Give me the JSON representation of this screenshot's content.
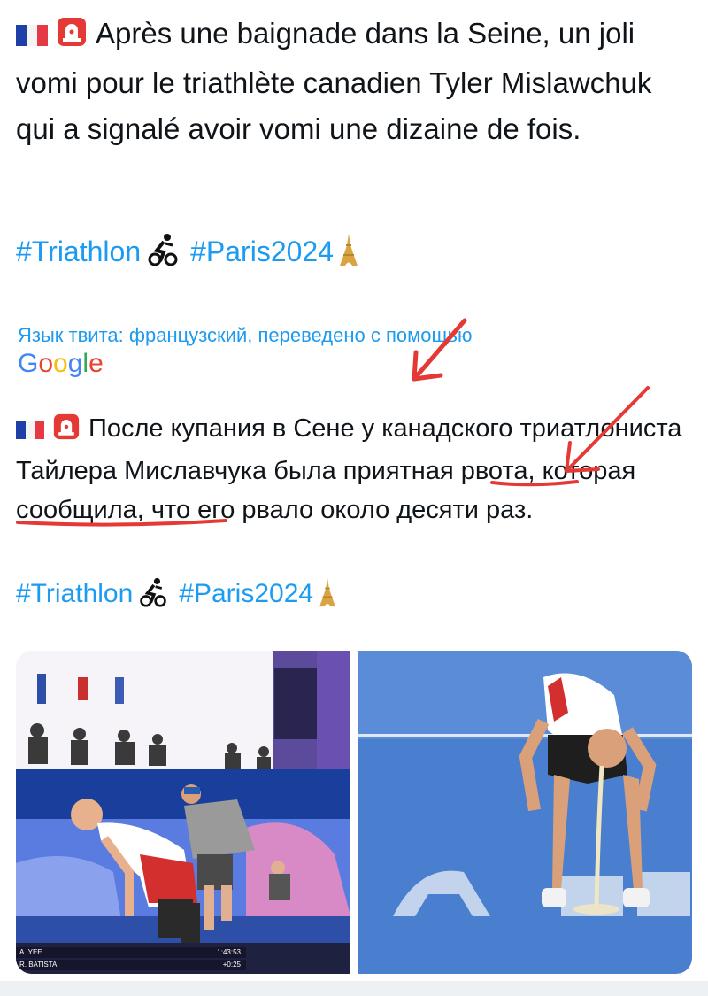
{
  "original": {
    "text": "Après une baignade dans la Seine, un joli vomi pour le triathlète canadien Tyler Mislawchuk qui a signalé avoir vomi une dizaine de fois.",
    "hashtags": [
      "#Triathlon",
      "#Paris2024"
    ]
  },
  "translation_notice": {
    "text": "Язык твита: французский, переведено с помощью",
    "provider": "Google"
  },
  "translated": {
    "text_part1": "После купания в Сене у канадского триатлониста Тайлера Миславчука ",
    "text_underlined": "была приятная рвота",
    "text_part2": ", которая сообщила, что его рвало около десяти раз.",
    "hashtags": [
      "#Triathlon",
      "#Paris2024"
    ]
  },
  "media": {
    "left": {
      "scoreboard": [
        {
          "name": "A. YEE",
          "time": "1:43:53"
        },
        {
          "name": "R. BATISTA",
          "time": "+0:25"
        }
      ]
    }
  },
  "colors": {
    "hashtag": "#1d9bf0",
    "annotation_red": "#e53935",
    "text": "#0f1419"
  }
}
